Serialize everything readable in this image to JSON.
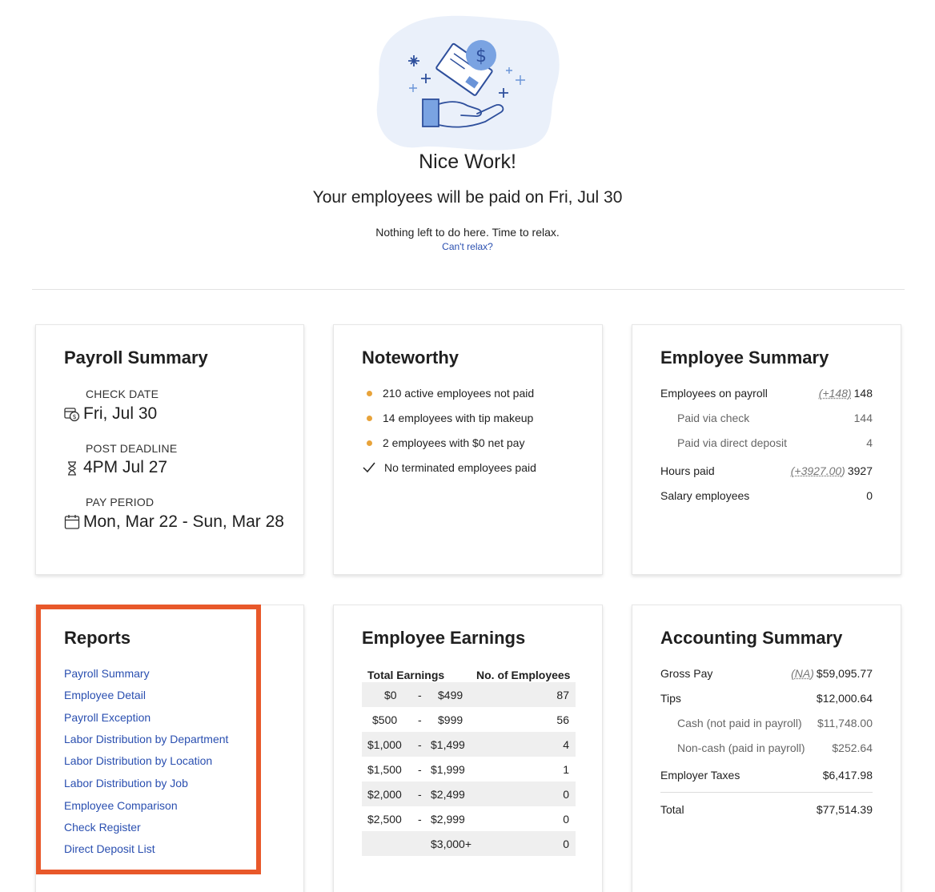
{
  "hero": {
    "title": "Nice Work!",
    "subtitle": "Your employees will be paid on Fri, Jul 30",
    "note": "Nothing left to do here. Time to relax.",
    "link": "Can't relax?",
    "illustration_icon": "hand-with-check-and-dollar-icon"
  },
  "payroll_summary": {
    "title": "Payroll Summary",
    "check_date_label": "CHECK DATE",
    "check_date": "Fri, Jul 30",
    "post_deadline_label": "POST DEADLINE",
    "post_deadline": "4PM Jul 27",
    "pay_period_label": "PAY PERIOD",
    "pay_period": "Mon, Mar 22 - Sun, Mar 28"
  },
  "noteworthy": {
    "title": "Noteworthy",
    "items": [
      {
        "text": "210 active employees not paid",
        "status": "warning"
      },
      {
        "text": "14 employees with tip makeup",
        "status": "warning"
      },
      {
        "text": "2 employees with $0 net pay",
        "status": "warning"
      },
      {
        "text": "No terminated employees paid",
        "status": "ok"
      }
    ],
    "warning_color": "#e8a33a"
  },
  "employee_summary": {
    "title": "Employee Summary",
    "rows": [
      {
        "label": "Employees on payroll",
        "delta": "(+148)",
        "value": "148"
      },
      {
        "label": "Paid via check",
        "value": "144"
      },
      {
        "label": "Paid via direct deposit",
        "value": "4"
      },
      {
        "label": "Hours paid",
        "delta": "(+3927.00)",
        "value": "3927"
      },
      {
        "label": "Salary employees",
        "value": "0"
      }
    ]
  },
  "reports": {
    "title": "Reports",
    "links": [
      "Payroll Summary",
      "Employee Detail",
      "Payroll Exception",
      "Labor Distribution by Department",
      "Labor Distribution by Location",
      "Labor Distribution by Job",
      "Employee Comparison",
      "Check Register",
      "Direct Deposit List"
    ],
    "highlight_color": "#e8582a"
  },
  "employee_earnings": {
    "title": "Employee Earnings",
    "col_total": "Total Earnings",
    "col_count": "No. of Employees",
    "rows": [
      {
        "from": "$0",
        "sep": "-",
        "to": "$499",
        "count": "87"
      },
      {
        "from": "$500",
        "sep": "-",
        "to": "$999",
        "count": "56"
      },
      {
        "from": "$1,000",
        "sep": "-",
        "to": "$1,499",
        "count": "4"
      },
      {
        "from": "$1,500",
        "sep": "-",
        "to": "$1,999",
        "count": "1"
      },
      {
        "from": "$2,000",
        "sep": "-",
        "to": "$2,499",
        "count": "0"
      },
      {
        "from": "$2,500",
        "sep": "-",
        "to": "$2,999",
        "count": "0"
      },
      {
        "from": "",
        "sep": "",
        "to": "$3,000+",
        "count": "0"
      }
    ]
  },
  "accounting_summary": {
    "title": "Accounting Summary",
    "gross_pay_label": "Gross Pay",
    "gross_pay_delta": "(NA)",
    "gross_pay": "$59,095.77",
    "tips_label": "Tips",
    "tips": "$12,000.64",
    "cash_label": "Cash (not paid in payroll)",
    "cash": "$11,748.00",
    "noncash_label": "Non-cash (paid in payroll)",
    "noncash": "$252.64",
    "employer_taxes_label": "Employer Taxes",
    "employer_taxes": "$6,417.98",
    "total_label": "Total",
    "total": "$77,514.39"
  }
}
